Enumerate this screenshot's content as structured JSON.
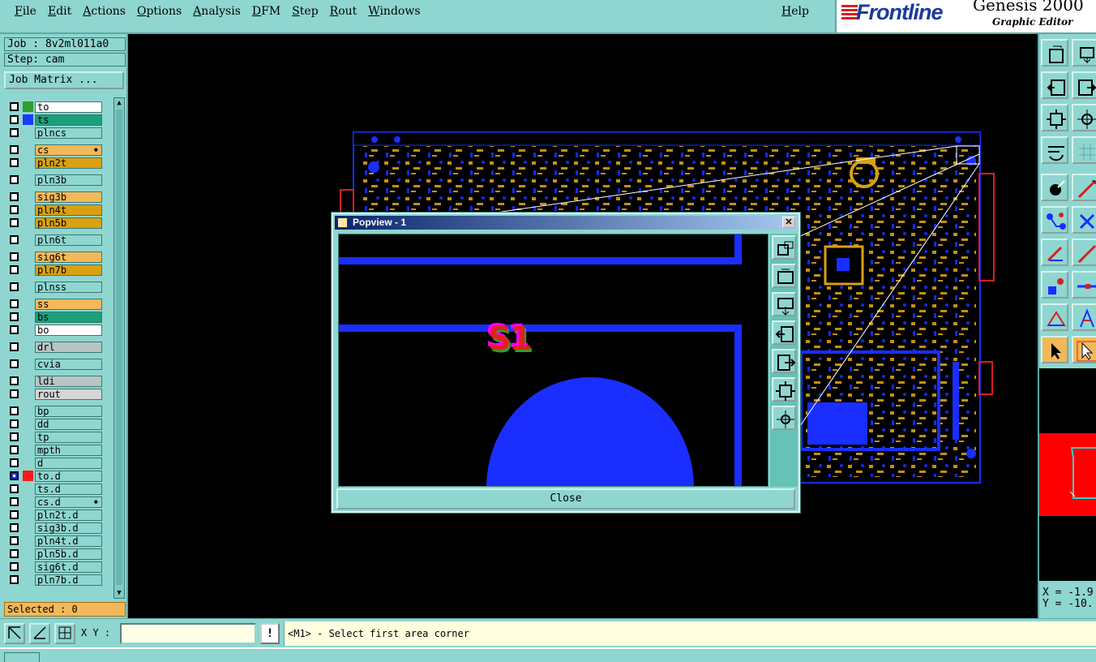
{
  "menu": {
    "items": [
      "File",
      "Edit",
      "Actions",
      "Options",
      "Analysis",
      "DFM",
      "Step",
      "Rout",
      "Windows"
    ],
    "help": "Help"
  },
  "logo": {
    "brand": "Frontline",
    "product": "Genesis 2000",
    "subtitle": "Graphic Editor"
  },
  "job": {
    "job_label": "Job : 8v2ml011a0",
    "step_label": "Step: cam",
    "matrix_button": "Job Matrix ..."
  },
  "layers": [
    {
      "name": "to",
      "color": "#ffffff",
      "swatch": "#2e9e2e"
    },
    {
      "name": "ts",
      "color": "#1aa07a",
      "swatch": "#1a3cff"
    },
    {
      "name": "plncs",
      "color": "#8fd6d0",
      "swatch": ""
    },
    {
      "name": "cs",
      "color": "#f2b85a",
      "swatch": ""
    },
    {
      "name": "pln2t",
      "color": "#d9a014",
      "swatch": ""
    },
    {
      "name": "pln3b",
      "color": "#8fd6d0",
      "swatch": ""
    },
    {
      "name": "sig3b",
      "color": "#f2b85a",
      "swatch": ""
    },
    {
      "name": "pln4t",
      "color": "#d9a014",
      "swatch": ""
    },
    {
      "name": "pln5b",
      "color": "#d9a014",
      "swatch": ""
    },
    {
      "name": "pln6t",
      "color": "#8fd6d0",
      "swatch": ""
    },
    {
      "name": "sig6t",
      "color": "#f2b85a",
      "swatch": ""
    },
    {
      "name": "pln7b",
      "color": "#d9a014",
      "swatch": ""
    },
    {
      "name": "plnss",
      "color": "#8fd6d0",
      "swatch": ""
    },
    {
      "name": "ss",
      "color": "#f2b85a",
      "swatch": ""
    },
    {
      "name": "bs",
      "color": "#1aa07a",
      "swatch": ""
    },
    {
      "name": "bo",
      "color": "#ffffff",
      "swatch": ""
    },
    {
      "name": "drl",
      "color": "#b8c4c4",
      "swatch": ""
    },
    {
      "name": "cvia",
      "color": "#8fd6d0",
      "swatch": ""
    },
    {
      "name": "ldi",
      "color": "#b8c4c4",
      "swatch": ""
    },
    {
      "name": "rout",
      "color": "#d6d6d6",
      "swatch": ""
    },
    {
      "name": "bp",
      "color": "#8fd6d0",
      "swatch": ""
    },
    {
      "name": "dd",
      "color": "#8fd6d0",
      "swatch": ""
    },
    {
      "name": "tp",
      "color": "#8fd6d0",
      "swatch": ""
    },
    {
      "name": "mpth",
      "color": "#8fd6d0",
      "swatch": ""
    },
    {
      "name": "d",
      "color": "#8fd6d0",
      "swatch": ""
    },
    {
      "name": "to.d",
      "color": "#8fd6d0",
      "swatch": "#ff1a1a"
    },
    {
      "name": "ts.d",
      "color": "#8fd6d0",
      "swatch": ""
    },
    {
      "name": "cs.d",
      "color": "#8fd6d0",
      "swatch": ""
    },
    {
      "name": "pln2t.d",
      "color": "#8fd6d0",
      "swatch": ""
    },
    {
      "name": "sig3b.d",
      "color": "#8fd6d0",
      "swatch": ""
    },
    {
      "name": "pln4t.d",
      "color": "#8fd6d0",
      "swatch": ""
    },
    {
      "name": "pln5b.d",
      "color": "#8fd6d0",
      "swatch": ""
    },
    {
      "name": "sig6t.d",
      "color": "#8fd6d0",
      "swatch": ""
    },
    {
      "name": "pln7b.d",
      "color": "#8fd6d0",
      "swatch": ""
    }
  ],
  "selected_label": "Selected : 0",
  "bottom": {
    "xy_label": "X Y :",
    "xy_value": "",
    "warn_glyph": "!",
    "prompt": "<M1> - Select first area corner"
  },
  "coords": {
    "x": "X = -1.9",
    "y": "Y = -10."
  },
  "popview": {
    "title": "Popview - 1",
    "close_glyph": "✕",
    "close_label": "Close",
    "annotation": "S1"
  },
  "colors": {
    "panel": "#8fd6d0",
    "trace": "#1a2eff",
    "component": "#d9a014",
    "highlight": "#f2b85a"
  }
}
